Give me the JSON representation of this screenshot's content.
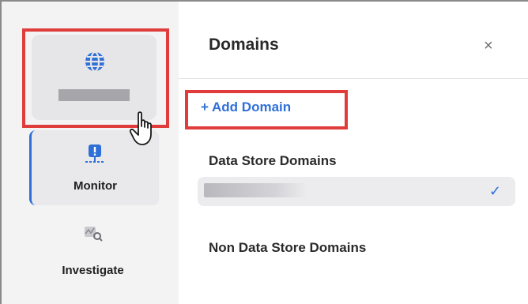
{
  "sidebar": {
    "items": [
      {
        "label": "",
        "icon": "globe-icon",
        "redacted": true
      },
      {
        "label": "Monitor",
        "icon": "monitor-alert-icon"
      },
      {
        "label": "Investigate",
        "icon": "investigate-icon"
      }
    ]
  },
  "panel": {
    "title": "Domains",
    "close_symbol": "×",
    "add_button_label": "+ Add Domain",
    "sections": [
      {
        "title": "Data Store Domains",
        "selected_check": "✓"
      },
      {
        "title": "Non Data Store Domains"
      }
    ]
  },
  "colors": {
    "accent": "#2f6fd8",
    "highlight": "#e03c3c",
    "sidebar_bg": "#f3f3f4"
  }
}
